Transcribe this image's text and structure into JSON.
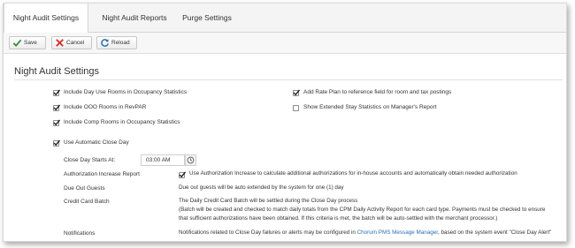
{
  "tabs": [
    {
      "label": "Night Audit Settings",
      "active": true
    },
    {
      "label": "Night Audit Reports",
      "active": false
    },
    {
      "label": "Purge Settings",
      "active": false
    }
  ],
  "toolbar": {
    "save_label": "Save",
    "cancel_label": "Cancel",
    "reload_label": "Reload"
  },
  "page_title": "Night Audit Settings",
  "options_left": [
    {
      "label": "Include Day Use Rooms in Occupancy Statistics",
      "checked": true
    },
    {
      "label": "Include OOO Rooms in RevPAR",
      "checked": true
    },
    {
      "label": "Include Comp Rooms in Occupancy Statistics",
      "checked": true
    }
  ],
  "options_right": [
    {
      "label": "Add Rate Plan to reference field for room and tax postings",
      "checked": true
    },
    {
      "label": "Show Extended Stay Statistics on Manager's Report",
      "checked": false
    }
  ],
  "auto_close": {
    "label": "Use Automatic Close Day",
    "checked": true
  },
  "close_day_start": {
    "label": "Close Day Starts At:",
    "value": "03:00 AM"
  },
  "authorization": {
    "label": "Authorization Increase Report",
    "checked": true,
    "text": "Use Authorization Increase to calculate additional authorizations for in-house accounts and automatically obtain needed authorization"
  },
  "due_out": {
    "label": "Due Out Guests",
    "text": "Due out guests will be auto extended by the system for one (1) day"
  },
  "credit_card": {
    "label": "Credit Card Batch",
    "line1": "The Daily Credit Card Batch will be settled during the Close Day process",
    "line2": "(Batch will be created and checked to match daily totals from the CPM Daily Activity Report for each card type. Payments must be checked to ensure",
    "line3": "that sufficient authorizations have been obtained. If this criteria is met, the batch will be auto-settled with the merchant processor.)"
  },
  "notifications": {
    "label": "Notifications",
    "text_before": "Notifications related to Close Day failures or alerts may be configured in ",
    "link": "Chorum PMS Message Manager",
    "text_after": ", based on the system event \"Close Day Alert\""
  },
  "colors": {
    "check_green": "#3a8a3a",
    "cancel_red": "#d9302c",
    "reload_blue": "#2a6fb5",
    "link_blue": "#2a6fb5"
  }
}
